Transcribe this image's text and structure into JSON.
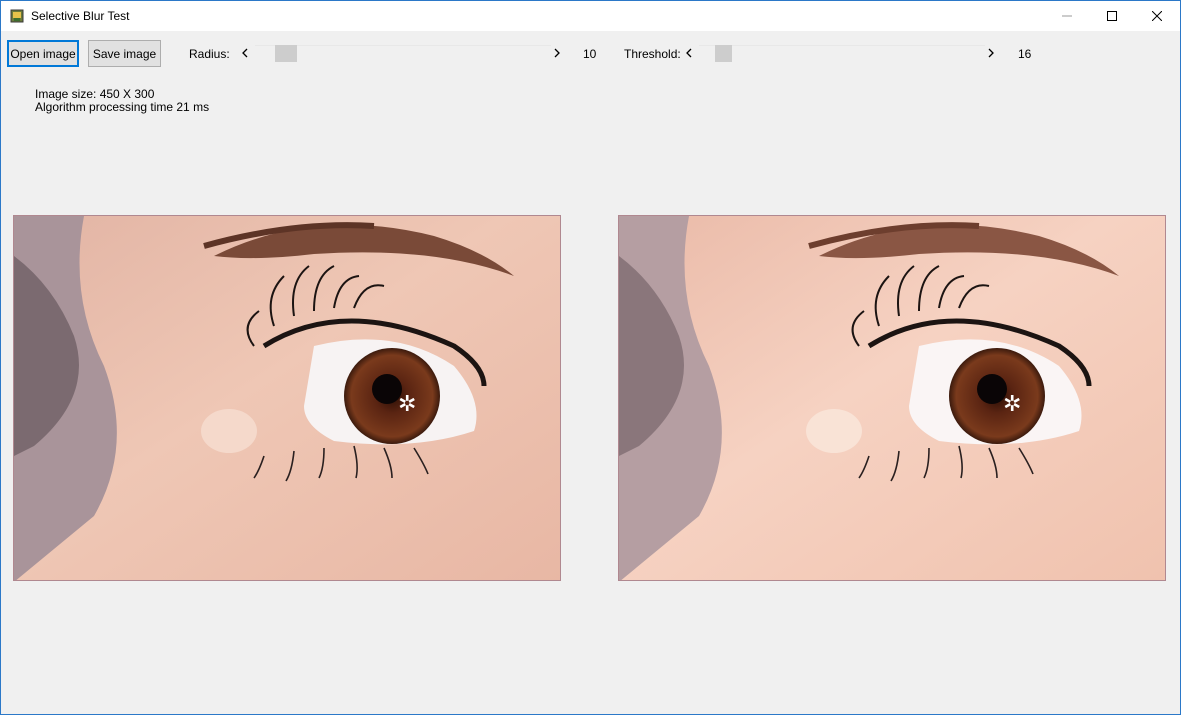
{
  "window": {
    "title": "Selective Blur Test",
    "accent_color": "#2b78c8"
  },
  "toolbar": {
    "open_label": "Open image",
    "save_label": "Save image",
    "radius_label": "Radius:",
    "radius_value": "10",
    "threshold_label": "Threshold:",
    "threshold_value": "16"
  },
  "info": {
    "image_size": "Image size: 450 X 300",
    "processing_time": "Algorithm processing time 21 ms"
  },
  "images": {
    "original_icon": "photo-original",
    "processed_icon": "photo-blurred"
  }
}
